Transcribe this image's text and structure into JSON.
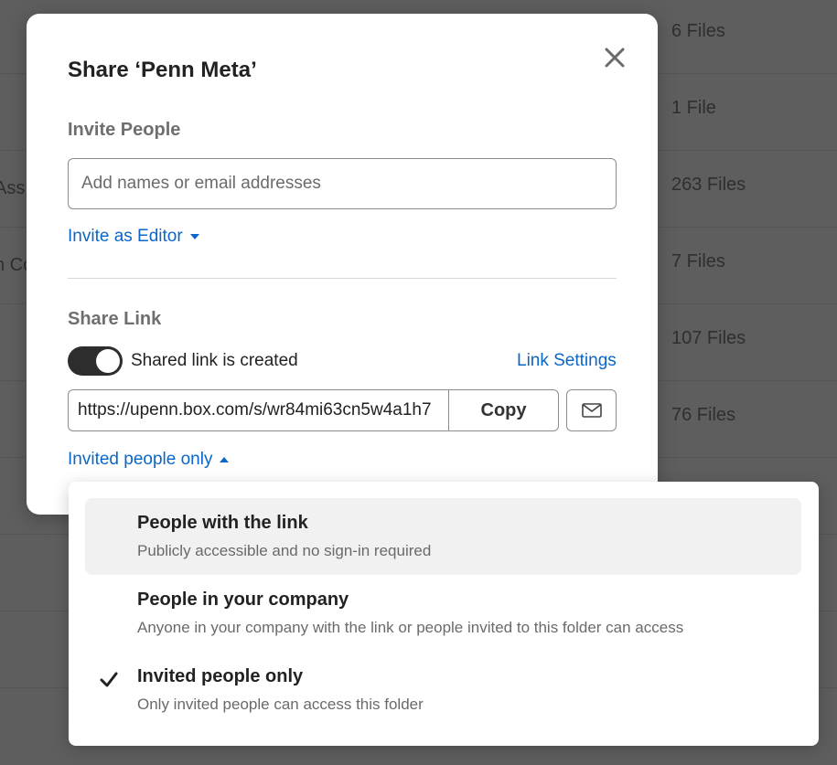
{
  "background": {
    "rows": [
      {
        "left_text": "",
        "count": "6 Files"
      },
      {
        "left_text": "",
        "count": "1 File"
      },
      {
        "left_text": "Ass",
        "count": "263 Files"
      },
      {
        "left_text": "n Co",
        "count": "7 Files"
      },
      {
        "left_text": "",
        "count": "107 Files"
      },
      {
        "left_text": "",
        "count": "76 Files"
      },
      {
        "left_text": "",
        "count": ""
      },
      {
        "left_text": "",
        "count": ""
      },
      {
        "left_text": "",
        "count": ""
      }
    ]
  },
  "modal": {
    "title": "Share ‘Penn Meta’",
    "close_icon": "close-icon",
    "invite": {
      "label": "Invite People",
      "placeholder": "Add names or email addresses",
      "role_dropdown": "Invite as Editor"
    },
    "share_link": {
      "label": "Share Link",
      "toggle_on": true,
      "toggle_label": "Shared link is created",
      "settings_link": "Link Settings",
      "url": "https://upenn.box.com/s/wr84mi63cn5w4a1h7",
      "copy_label": "Copy",
      "email_icon": "envelope-icon",
      "access_dropdown": "Invited people only"
    }
  },
  "access_menu": {
    "items": [
      {
        "title": "People with the link",
        "description": "Publicly accessible and no sign-in required",
        "selected": false,
        "highlighted": true
      },
      {
        "title": "People in your company",
        "description": "Anyone in your company with the link or people invited to this folder can access",
        "selected": false,
        "highlighted": false
      },
      {
        "title": "Invited people only",
        "description": "Only invited people can access this folder",
        "selected": true,
        "highlighted": false
      }
    ]
  },
  "colors": {
    "accent": "#0a66c8",
    "toggle_on": "#2d2d2d",
    "overlay": "#5e5e5e"
  }
}
